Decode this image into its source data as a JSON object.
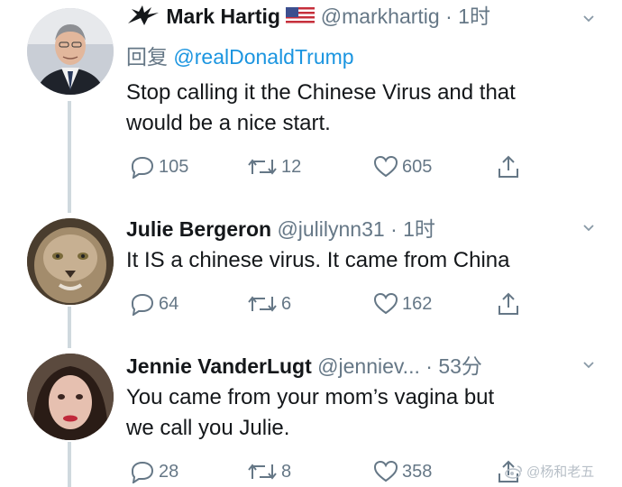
{
  "tweets": [
    {
      "name": "Mark Hartig",
      "has_bird": true,
      "has_flag": true,
      "handle": "@markhartig",
      "separator": "·",
      "time": "1时",
      "reply_prefix": "回复",
      "reply_mention": "@realDonaldTrump",
      "text_line1": "Stop calling it the Chinese Virus and that",
      "text_line2": "would be a nice start.",
      "replies": "105",
      "retweets": "12",
      "likes": "605"
    },
    {
      "name": "Julie Bergeron",
      "handle": "@julilynn31",
      "separator": "·",
      "time": "1时",
      "text_line1": "It IS a chinese virus. It came from China",
      "replies": "64",
      "retweets": "6",
      "likes": "162"
    },
    {
      "name": "Jennie VanderLugt",
      "handle": "@jenniev...",
      "separator": "·",
      "time": "53分",
      "text_line1": "You came from your mom’s vagina but",
      "text_line2": "we call you Julie.",
      "replies": "28",
      "retweets": "8",
      "likes": "358"
    }
  ],
  "watermark": "@杨和老五",
  "colors": {
    "secondary_text": "#657786",
    "mention": "#1b95e0",
    "thread_line": "#cfd9de"
  }
}
